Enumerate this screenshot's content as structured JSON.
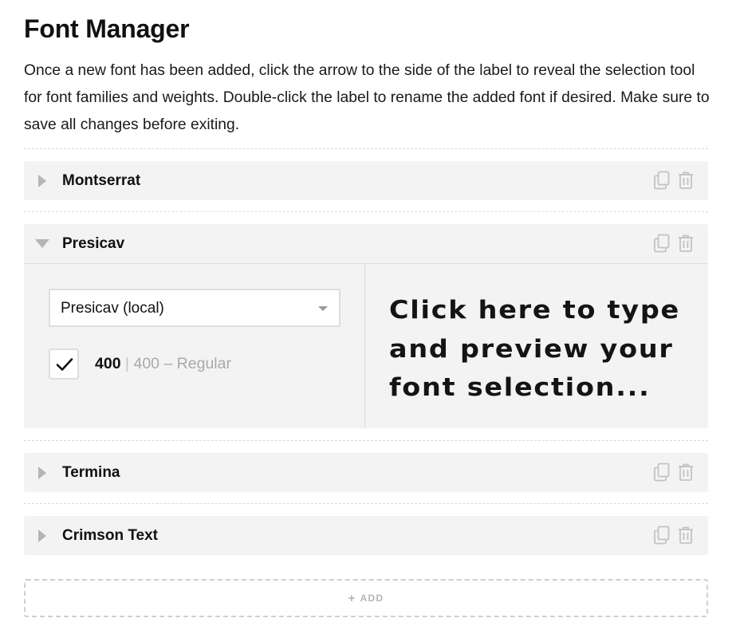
{
  "page": {
    "title": "Font Manager",
    "description": "Once a new font has been added, click the arrow to the side of the label to reveal the selection tool for font families and weights. Double-click the label to rename the added font if desired. Make sure to save all changes before exiting."
  },
  "fonts": [
    {
      "label": "Montserrat",
      "expanded": false
    },
    {
      "label": "Presicav",
      "expanded": true,
      "family_select": {
        "value": "Presicav (local)"
      },
      "weights": [
        {
          "value": "400",
          "separator": "|",
          "description": "400 – Regular",
          "checked": true
        }
      ],
      "preview_text": "Click here to type and preview your font selection..."
    },
    {
      "label": "Termina",
      "expanded": false
    },
    {
      "label": "Crimson Text",
      "expanded": false
    }
  ],
  "add_button": {
    "icon": "+",
    "label": "ADD"
  },
  "icons": {
    "copy": "copy-icon",
    "delete": "trash-icon",
    "collapsed": "caret-right-icon",
    "expanded": "caret-down-icon"
  },
  "colors": {
    "row_background": "#f3f3f3",
    "icon_gray": "#b5b5b5",
    "text": "#111111"
  }
}
